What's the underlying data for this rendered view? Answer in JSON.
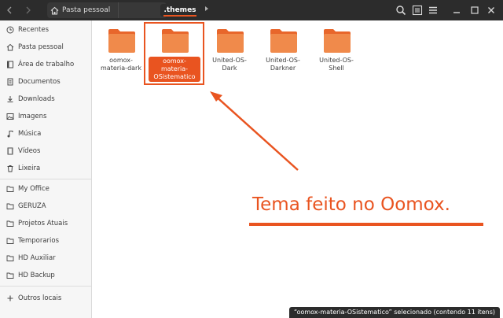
{
  "header": {
    "back_icon": "chevron-left-icon",
    "forward_icon": "chevron-right-icon",
    "path": [
      {
        "label": "Pasta pessoal",
        "icon": "home-icon"
      },
      {
        "label": ".themes"
      }
    ],
    "more_icon": "triangle-right-icon",
    "actions": [
      "search-icon",
      "view-list-icon",
      "menu-icon",
      "minimize-icon",
      "maximize-icon",
      "close-icon"
    ]
  },
  "sidebar": {
    "places": [
      {
        "label": "Recentes",
        "icon": "clock-icon"
      },
      {
        "label": "Pasta pessoal",
        "icon": "home-icon"
      },
      {
        "label": "Área de trabalho",
        "icon": "desktop-icon"
      },
      {
        "label": "Documentos",
        "icon": "document-icon"
      },
      {
        "label": "Downloads",
        "icon": "download-icon"
      },
      {
        "label": "Imagens",
        "icon": "image-icon"
      },
      {
        "label": "Música",
        "icon": "music-icon"
      },
      {
        "label": "Vídeos",
        "icon": "video-icon"
      },
      {
        "label": "Lixeira",
        "icon": "trash-icon"
      }
    ],
    "bookmarks": [
      {
        "label": "My Office",
        "icon": "folder-icon"
      },
      {
        "label": "GERUZA",
        "icon": "folder-icon"
      },
      {
        "label": "Projetos Atuais",
        "icon": "folder-icon"
      },
      {
        "label": "Temporarios",
        "icon": "folder-icon"
      },
      {
        "label": "HD Auxiliar",
        "icon": "folder-icon"
      },
      {
        "label": "HD Backup",
        "icon": "folder-icon"
      }
    ],
    "other": {
      "label": "Outros locais",
      "icon": "plus-icon"
    }
  },
  "files": [
    {
      "name": "oomox-\nmateria-dark",
      "selected": false
    },
    {
      "name": "oomox-\nmateria-\nOSistematico",
      "selected": true
    },
    {
      "name": "United-OS-\nDark",
      "selected": false
    },
    {
      "name": "United-OS-\nDarkner",
      "selected": false
    },
    {
      "name": "United-OS-\nShell",
      "selected": false
    }
  ],
  "annotation": {
    "text": "Tema feito no Oomox."
  },
  "status": {
    "text": "“oomox-materia-OSistematico” selecionado  (contendo 11 itens)"
  },
  "colors": {
    "accent": "#e95420",
    "folder": "#f08a4b",
    "folder_tab": "#e8662b",
    "headerbar": "#2c2c2c"
  }
}
